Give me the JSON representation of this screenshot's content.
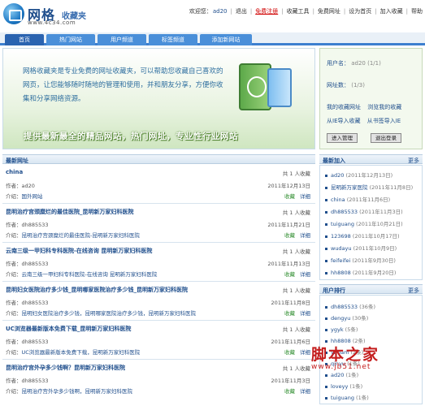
{
  "header": {
    "logo_cn": "网格",
    "logo_sub": "收藏夹",
    "logo_url": "www.4c34.com",
    "top_links": [
      "欢迎您：",
      "ad20",
      "退出",
      "免费注册",
      "收藏工具",
      "免费网址",
      "设为首页",
      "加入收藏",
      "帮助"
    ]
  },
  "nav": {
    "tabs": [
      "首页",
      "热门网站",
      "用户频道",
      "标签频道",
      "添加新网站"
    ]
  },
  "banner": {
    "text": "网格收藏夹是专业免费的网址收藏夹，可以帮助您收藏自己喜欢的网页，让您能够随时随地的管理和使用，并和朋友分享，方便你收集和分享网络资源。",
    "slogan": "提供最新最全的精品网站，热门网址，专业性行业网站"
  },
  "login": {
    "user_label": "用户名：",
    "user_value": "ad20",
    "user_tail": "(1/1)",
    "count_label": "网址数：",
    "count_value": "(1/3)",
    "link1": "我的收藏网址",
    "link2": "浏览我的收藏",
    "link3": "从IE导入收藏",
    "link4": "从书签导入IE",
    "btn1": "进入管理",
    "btn2": "退出登录"
  },
  "main": {
    "section_title": "最新网址",
    "entries": [
      {
        "title": "china",
        "count": "共 1 人收藏",
        "author": "作者：ad20",
        "date": "2011年12月13日",
        "intro_label": "介绍：",
        "intro": "国外网站",
        "fav": "收藏",
        "detail": "详细"
      },
      {
        "title": "昆明治疗宫颈糜烂的最佳医院_昆明新万家妇科医院",
        "count": "共 1 人收藏",
        "author": "作者：dh885533",
        "date": "2011年11月21日",
        "intro_label": "介绍：",
        "intro": "昆明治疗宫颈糜烂的最佳医院-昆明新万家妇科医院",
        "fav": "收藏",
        "detail": "详细"
      },
      {
        "title": "云南三级一甲妇科专科医院-在线咨询 昆明新万家妇科医院",
        "count": "共 1 人收藏",
        "author": "作者：dh885533",
        "date": "2011年11月13日",
        "intro_label": "介绍：",
        "intro": "云南三级一甲妇科专科医院-在线咨询 昆明新万家妇科医院",
        "fav": "收藏",
        "detail": "详细"
      },
      {
        "title": "昆明妇女医院治疗多少钱_昆明哪家医院治疗多少钱_昆明新万家妇科医院",
        "count": "共 1 人收藏",
        "author": "作者：dh885533",
        "date": "2011年11月8日",
        "intro_label": "介绍：",
        "intro": "昆明妇女医院治疗多少钱，昆明哪家医院治疗多少钱，昆明新万家妇科医院",
        "fav": "收藏",
        "detail": "详细"
      },
      {
        "title": "UC浏览器最新版本免费下载_昆明新万家妇科医院",
        "count": "共 1 人收藏",
        "author": "作者：dh885533",
        "date": "2011年11月6日",
        "intro_label": "介绍：",
        "intro": "UC浏览器最新版本免费下载，昆明新万家妇科医院",
        "fav": "收藏",
        "detail": "详细"
      },
      {
        "title": "昆明治疗宫外孕多少钱啊？昆明新万家妇科医院",
        "count": "共 1 人收藏",
        "author": "作者：dh885533",
        "date": "2011年11月3日",
        "intro_label": "介绍：",
        "intro": "昆明治疗宫外孕多少钱啊，昆明新万家妇科医院",
        "fav": "收藏",
        "detail": "详细"
      }
    ]
  },
  "recent": {
    "title": "最新加入",
    "more": "更多",
    "items": [
      {
        "name": "ad20",
        "meta": "(2011年12月13日)"
      },
      {
        "name": "昆明新万家医院",
        "meta": "(2011年11月8日)"
      },
      {
        "name": "china",
        "meta": "(2011年11月6日)"
      },
      {
        "name": "dh885533",
        "meta": "(2011年11月3日)"
      },
      {
        "name": "tuiguang",
        "meta": "(2011年10月21日)"
      },
      {
        "name": "123698",
        "meta": "(2011年10月17日)"
      },
      {
        "name": "wudayu",
        "meta": "(2011年10月9日)"
      },
      {
        "name": "feifeifei",
        "meta": "(2011年9月30日)"
      },
      {
        "name": "hh8808",
        "meta": "(2011年9月20日)"
      }
    ]
  },
  "ranking": {
    "title": "用户排行",
    "more": "更多",
    "items": [
      {
        "name": "dh885533",
        "meta": "(36条)"
      },
      {
        "name": "dengyu",
        "meta": "(30条)"
      },
      {
        "name": "ygyk",
        "meta": "(5条)"
      },
      {
        "name": "hh8808",
        "meta": "(2条)"
      },
      {
        "name": "ybbam",
        "meta": "(2条)"
      },
      {
        "name": "qinyu",
        "meta": "(1条)"
      },
      {
        "name": "ad20",
        "meta": "(1条)"
      },
      {
        "name": "loveyy",
        "meta": "(1条)"
      },
      {
        "name": "tuiguang",
        "meta": "(1条)"
      }
    ]
  },
  "watermark": {
    "big": "脚本之家",
    "small": "www.jb51.net"
  }
}
